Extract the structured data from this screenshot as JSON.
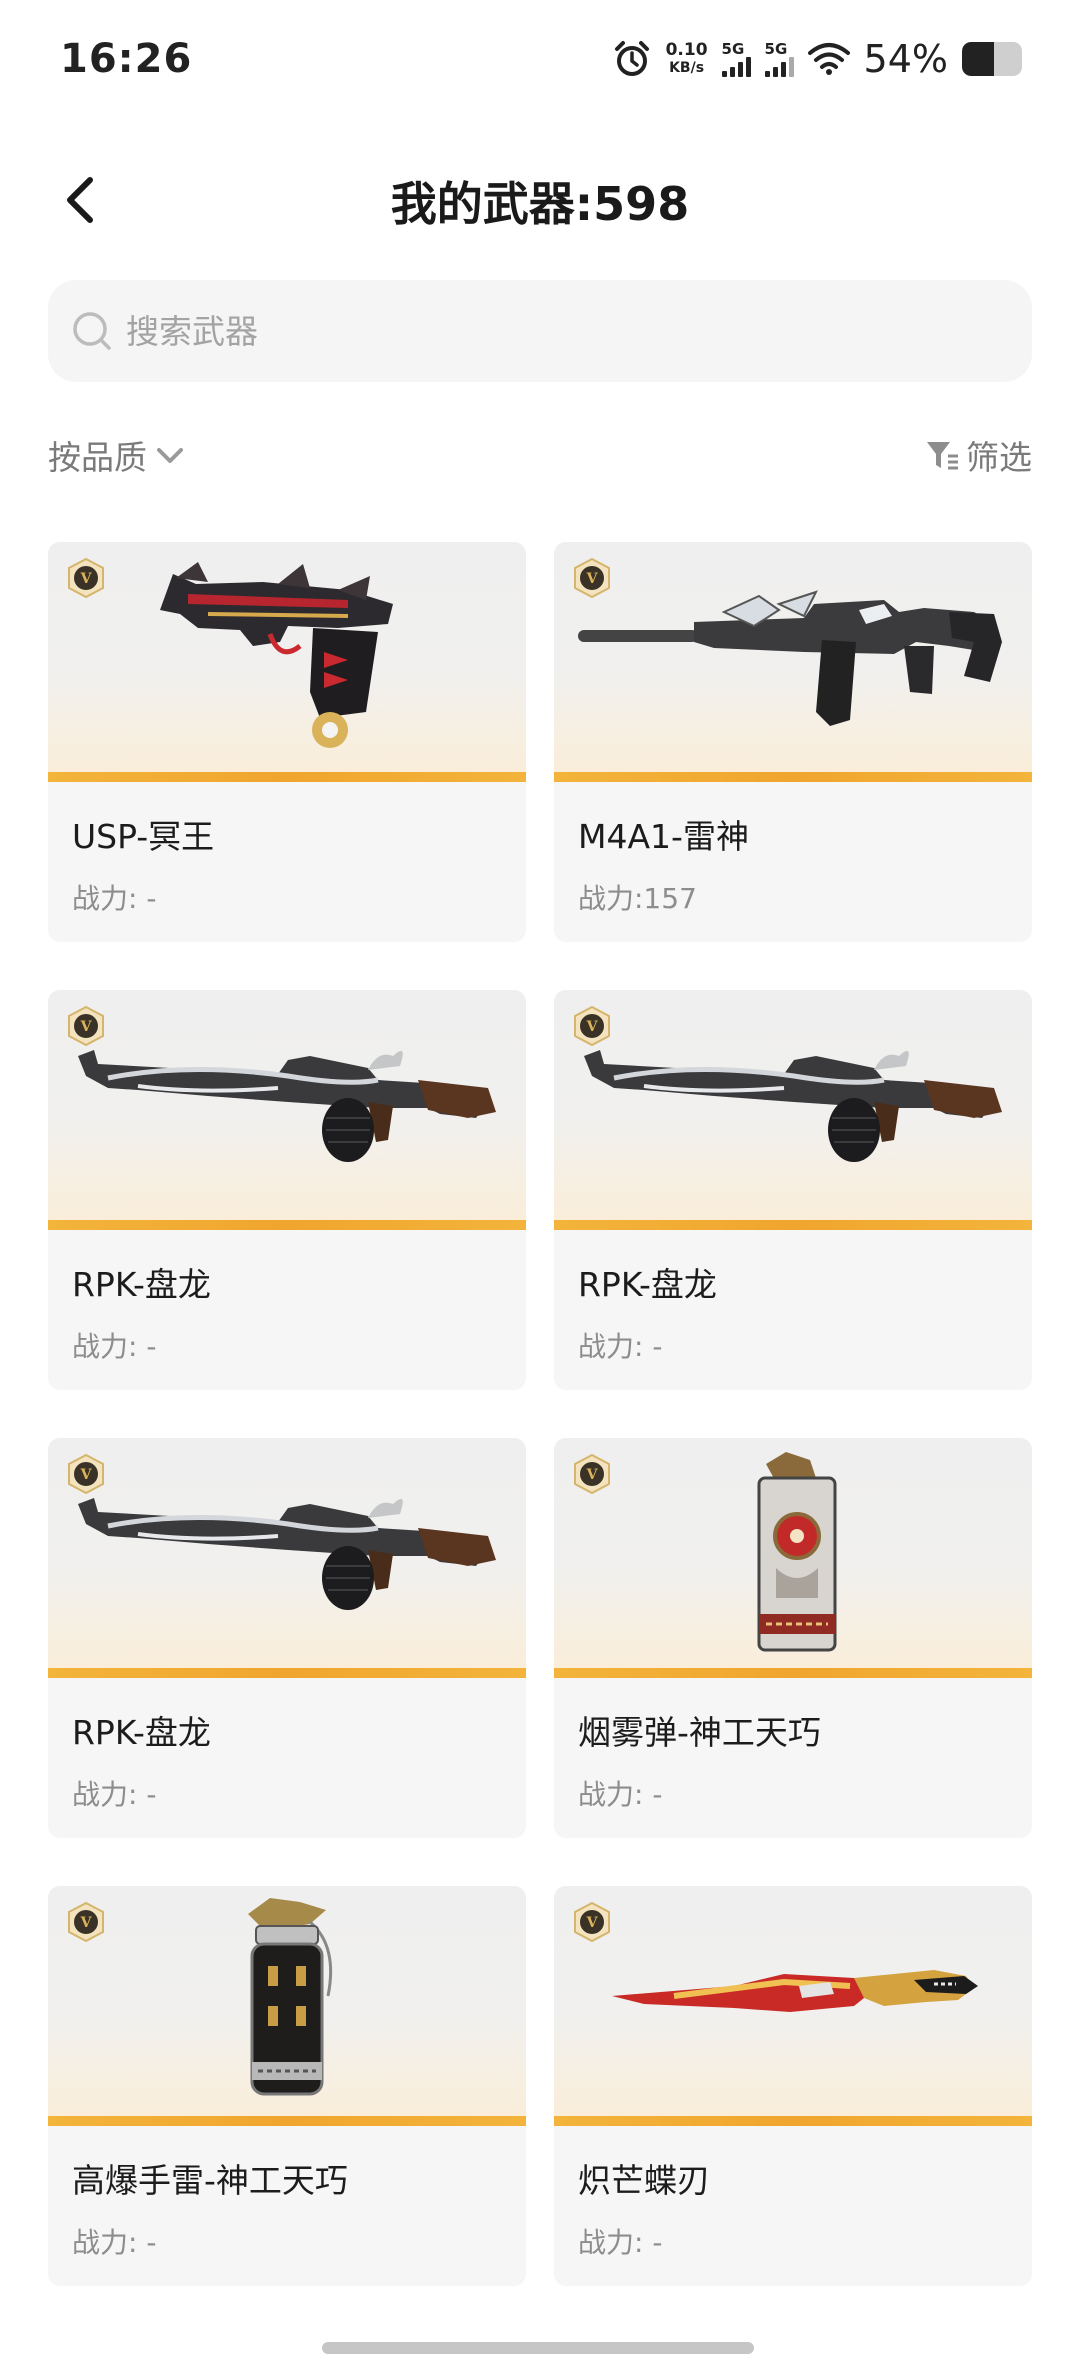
{
  "status_bar": {
    "time": "16:26",
    "net_speed_value": "0.10",
    "net_speed_unit": "KB/s",
    "sim1": "5G",
    "sim2": "5G",
    "battery_percent": "54%",
    "battery_level": 0.54
  },
  "header": {
    "title": "我的武器:598",
    "back_icon": "chevron-left-icon"
  },
  "search": {
    "placeholder": "搜索武器",
    "value": "",
    "icon": "search-icon"
  },
  "sort": {
    "label": "按品质",
    "icon": "chevron-down-icon"
  },
  "filter": {
    "label": "筛选",
    "icon": "filter-icon"
  },
  "weapons": [
    {
      "name": "USP-冥王",
      "power": "战力: -",
      "badge": "V",
      "kind": "pistol"
    },
    {
      "name": "M4A1-雷神",
      "power": "战力:157",
      "badge": "V",
      "kind": "rifle"
    },
    {
      "name": "RPK-盘龙",
      "power": "战力: -",
      "badge": "V",
      "kind": "rpk"
    },
    {
      "name": "RPK-盘龙",
      "power": "战力: -",
      "badge": "V",
      "kind": "rpk"
    },
    {
      "name": "RPK-盘龙",
      "power": "战力: -",
      "badge": "V",
      "kind": "rpk"
    },
    {
      "name": "烟雾弹-神工天巧",
      "power": "战力: -",
      "badge": "V",
      "kind": "smoke"
    },
    {
      "name": "高爆手雷-神工天巧",
      "power": "战力: -",
      "badge": "V",
      "kind": "grenade"
    },
    {
      "name": "炽芒蝶刃",
      "power": "战力: -",
      "badge": "V",
      "kind": "knife"
    }
  ],
  "colors": {
    "accent_stripe": "#f0a52e",
    "badge_gold": "#c9a24a",
    "card_bg": "#f6f6f6"
  }
}
